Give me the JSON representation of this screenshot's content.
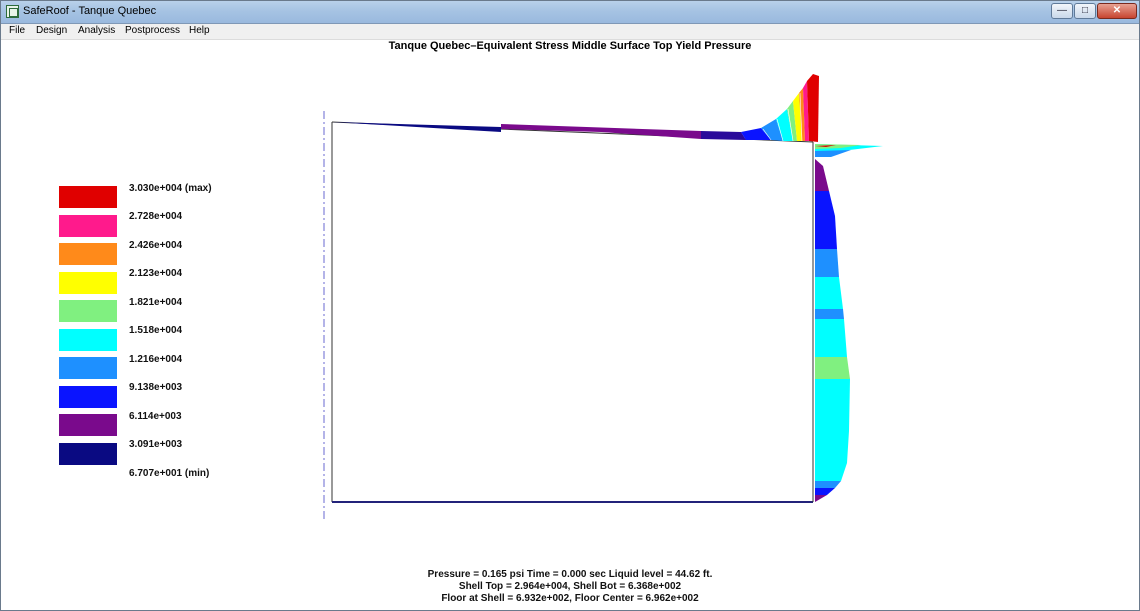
{
  "window": {
    "title": "SafeRoof - Tanque Quebec",
    "controls": {
      "minimize": "—",
      "maximize": "□",
      "close": "✕"
    }
  },
  "menu": {
    "items": [
      "File",
      "Design",
      "Analysis",
      "Postprocess",
      "Help"
    ]
  },
  "plot": {
    "title": "Tanque Quebec–Equivalent Stress  Middle Surface  Top Yield Pressure"
  },
  "legend": {
    "entries": [
      {
        "label": "3.030e+004 (max)",
        "color": "#e00000"
      },
      {
        "label": "2.728e+004",
        "color": "#ff1a8c"
      },
      {
        "label": "2.426e+004",
        "color": "#ff8a1a"
      },
      {
        "label": "2.123e+004",
        "color": "#ffff00"
      },
      {
        "label": "1.821e+004",
        "color": "#80f080"
      },
      {
        "label": "1.518e+004",
        "color": "#00ffff"
      },
      {
        "label": "1.216e+004",
        "color": "#1e90ff"
      },
      {
        "label": "9.138e+003",
        "color": "#0a14ff"
      },
      {
        "label": "6.114e+003",
        "color": "#7a0a8c"
      },
      {
        "label": "3.091e+003",
        "color": "#0a0a82"
      }
    ],
    "min_label": "6.707e+001 (min)"
  },
  "footer": {
    "line1": "Pressure =  0.165 psi   Time = 0.000 sec   Liquid level = 44.62 ft.",
    "line2": "Shell Top = 2.964e+004,  Shell Bot = 6.368e+002",
    "line3": "Floor at Shell = 6.932e+002, Floor Center = 6.962e+002"
  }
}
